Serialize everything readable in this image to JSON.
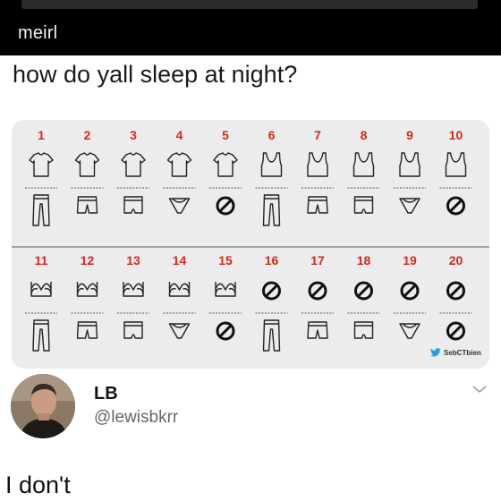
{
  "header": {
    "subreddit": "meirl"
  },
  "post": {
    "title": "how do yall sleep at night?"
  },
  "chart_data": {
    "type": "table",
    "rows": [
      {
        "numbers": [
          "1",
          "2",
          "3",
          "4",
          "5",
          "6",
          "7",
          "8",
          "9",
          "10"
        ],
        "tops": [
          "tshirt",
          "tshirt",
          "tshirt",
          "tshirt",
          "tshirt",
          "tank",
          "tank",
          "tank",
          "tank",
          "tank"
        ],
        "bottoms": [
          "pants",
          "shorts",
          "boxers",
          "briefs",
          "none",
          "pants",
          "shorts",
          "boxers",
          "briefs",
          "none"
        ]
      },
      {
        "numbers": [
          "11",
          "12",
          "13",
          "14",
          "15",
          "16",
          "17",
          "18",
          "19",
          "20"
        ],
        "tops": [
          "bra",
          "bra",
          "bra",
          "bra",
          "bra",
          "none",
          "none",
          "none",
          "none",
          "none"
        ],
        "bottoms": [
          "pants",
          "shorts",
          "boxers",
          "briefs",
          "none",
          "pants",
          "shorts",
          "boxers",
          "briefs",
          "none"
        ]
      }
    ],
    "number_color": "#d6281f"
  },
  "watermark": {
    "text": "SebCTbien",
    "icon": "twitter-bird-icon"
  },
  "tweet": {
    "name": "LB",
    "handle": "@lewisbkrr",
    "text": "I don't"
  },
  "colors": {
    "accent": "#d6281f",
    "twitter": "#1da1f2"
  }
}
